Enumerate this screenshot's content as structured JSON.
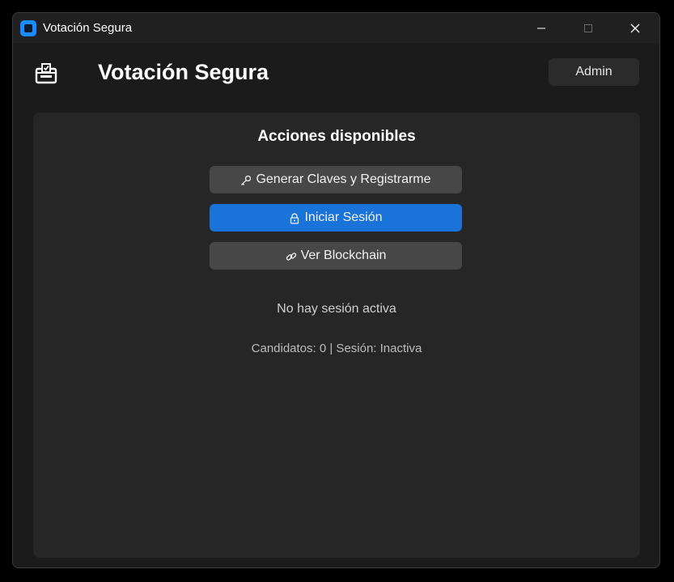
{
  "window": {
    "title": "Votación Segura",
    "controls": [
      "minimize-icon",
      "maximize-icon",
      "close-icon"
    ]
  },
  "header": {
    "icon": "ballot-box-icon",
    "title": "Votación Segura",
    "admin_label": "Admin"
  },
  "panel": {
    "title": "Acciones disponibles",
    "actions": [
      {
        "label": "Generar Claves y Registrarme",
        "icon": "key-icon",
        "style": "gray"
      },
      {
        "label": "Iniciar Sesión",
        "icon": "lock-icon",
        "style": "blue"
      },
      {
        "label": "Ver Blockchain",
        "icon": "link-icon",
        "style": "gray"
      }
    ],
    "session_status": "No hay sesión activa",
    "info": "Candidatos: 0 | Sesión: Inactiva"
  },
  "colors": {
    "background": "#1b1b1b",
    "panel": "#262626",
    "button_gray": "#474747",
    "button_blue": "#1a73d8",
    "text": "#ffffff",
    "muted_text": "#cfcfcf"
  }
}
